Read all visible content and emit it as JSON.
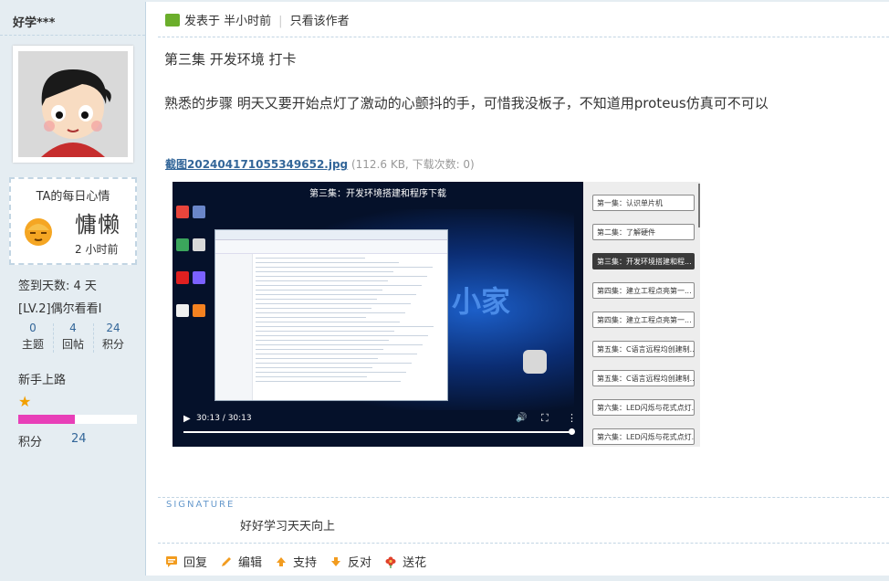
{
  "user": {
    "name": "好学***",
    "mood_title": "TA的每日心情",
    "mood_word": "慵懒",
    "mood_time": "2 小时前",
    "checkin": "签到天数: 4 天",
    "level": "[LV.2]偶尔看看I",
    "stats": [
      {
        "value": "0",
        "label": "主题"
      },
      {
        "value": "4",
        "label": "回帖"
      },
      {
        "value": "24",
        "label": "积分"
      }
    ],
    "rank": "新手上路",
    "score_label": "积分",
    "score_value": "24",
    "progress_fraction": 0.48,
    "star_color": "#f2a000",
    "progress_color": "#e83fb8"
  },
  "post": {
    "posted_prefix": "发表于",
    "posted_time": "半小时前",
    "only_author": "只看该作者",
    "title": "第三集 开发环境 打卡",
    "body": "熟悉的步骤 明天又要开始点灯了激动的心颤抖的手，可惜我没板子，不知道用proteus仿真可不可以",
    "attachment_name": "截图20240417105534965​2.jpg",
    "attachment_meta": "(112.6 KB, 下载次数: 0)"
  },
  "screenshot": {
    "video_title": "第三集：开发环境搭建和程序下载",
    "video_time": "30:13 / 30:13",
    "overlay_word": "小家",
    "progress_fraction": 1.0,
    "episodes": [
      "第一集：认识单片机",
      "第二集：了解硬件",
      "第三集：开发环境搭建和程...",
      "第四集：建立工程点亮第一...",
      "第四集：建立工程点亮第一...",
      "第五集：C语言远程均创建制...",
      "第五集：C语言远程均创建制...",
      "第六集：LED闪烁与花式点灯...",
      "第六集：LED闪烁与花式点灯..."
    ],
    "active_episode_index": 2
  },
  "signature": {
    "label": "SIGNATURE",
    "text": "好好学习天天向上"
  },
  "actions": [
    {
      "label": "回复",
      "icon": "reply-icon",
      "color": "#f29c1f"
    },
    {
      "label": "编辑",
      "icon": "edit-icon",
      "color": "#f29c1f"
    },
    {
      "label": "支持",
      "icon": "thumb-up-icon",
      "color": "#f29c1f"
    },
    {
      "label": "反对",
      "icon": "thumb-down-icon",
      "color": "#f29c1f"
    },
    {
      "label": "送花",
      "icon": "flower-icon",
      "color": "#e0412b"
    }
  ]
}
